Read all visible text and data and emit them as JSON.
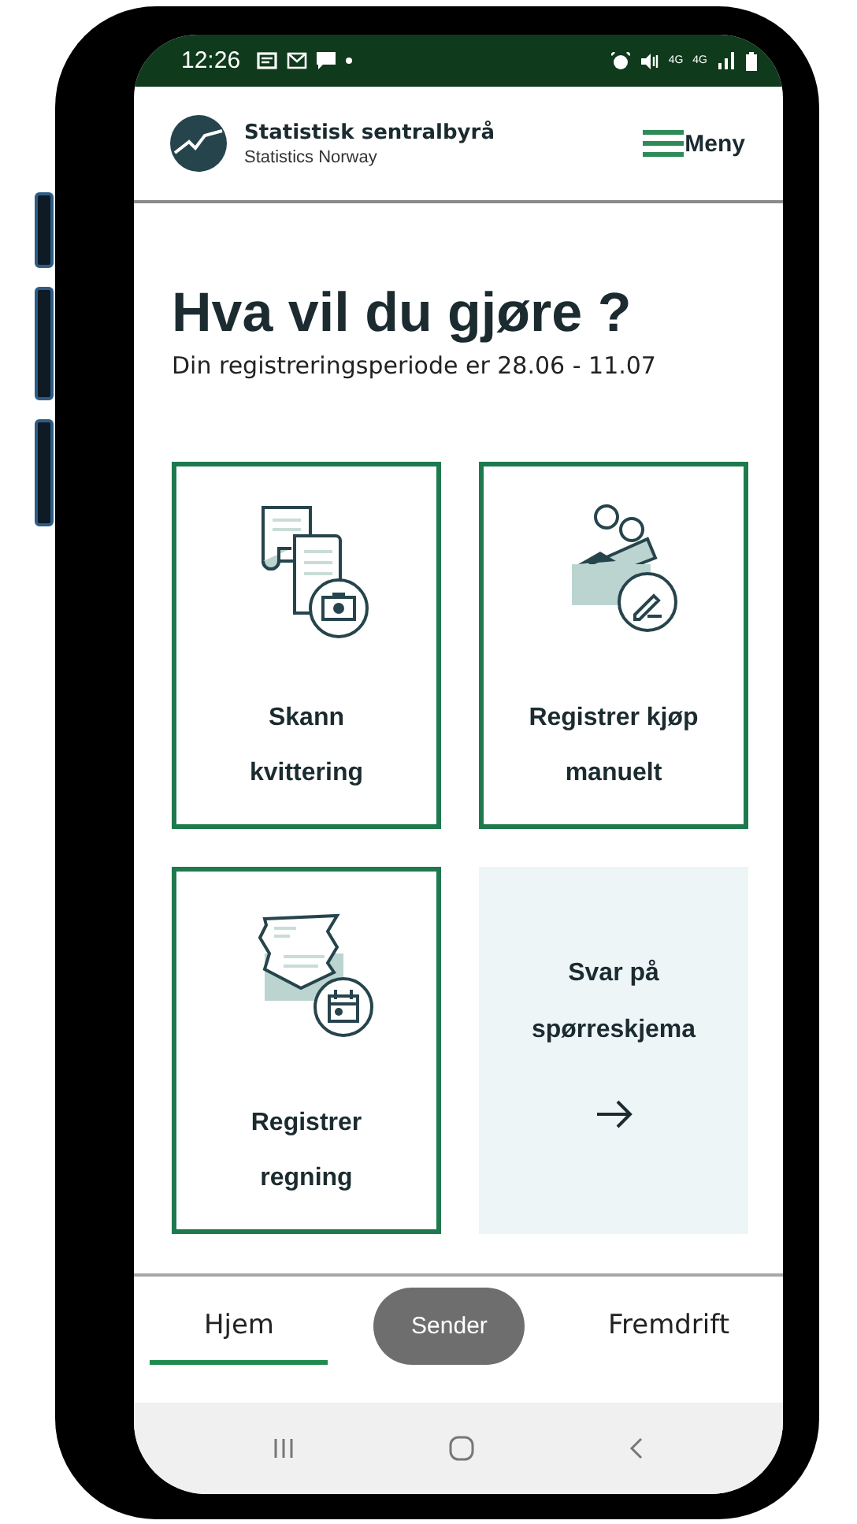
{
  "status_bar": {
    "time": "12:26",
    "network_labels": [
      "4G",
      "4G"
    ]
  },
  "header": {
    "logo_title": "Statistisk sentralbyrå",
    "logo_subtitle": "Statistics Norway",
    "menu_label": "Meny"
  },
  "heading": "Hva vil du gjøre ?",
  "subheading": "Din registreringsperiode er 28.06 - 11.07",
  "cards": [
    {
      "kind": "scan",
      "label_lines": [
        "Skann",
        "kvittering"
      ]
    },
    {
      "kind": "manual",
      "label_lines": [
        "Registrer kjøp",
        "manuelt"
      ]
    },
    {
      "kind": "bill",
      "label_lines": [
        "Registrer",
        "regning"
      ]
    }
  ],
  "survey_card": {
    "label_lines": [
      "Svar på",
      "spørreskjema"
    ]
  },
  "tabs": [
    {
      "label": "Hjem",
      "selected": true
    },
    {
      "label": "Fremdrift",
      "selected": false
    }
  ],
  "toast": "Sender"
}
